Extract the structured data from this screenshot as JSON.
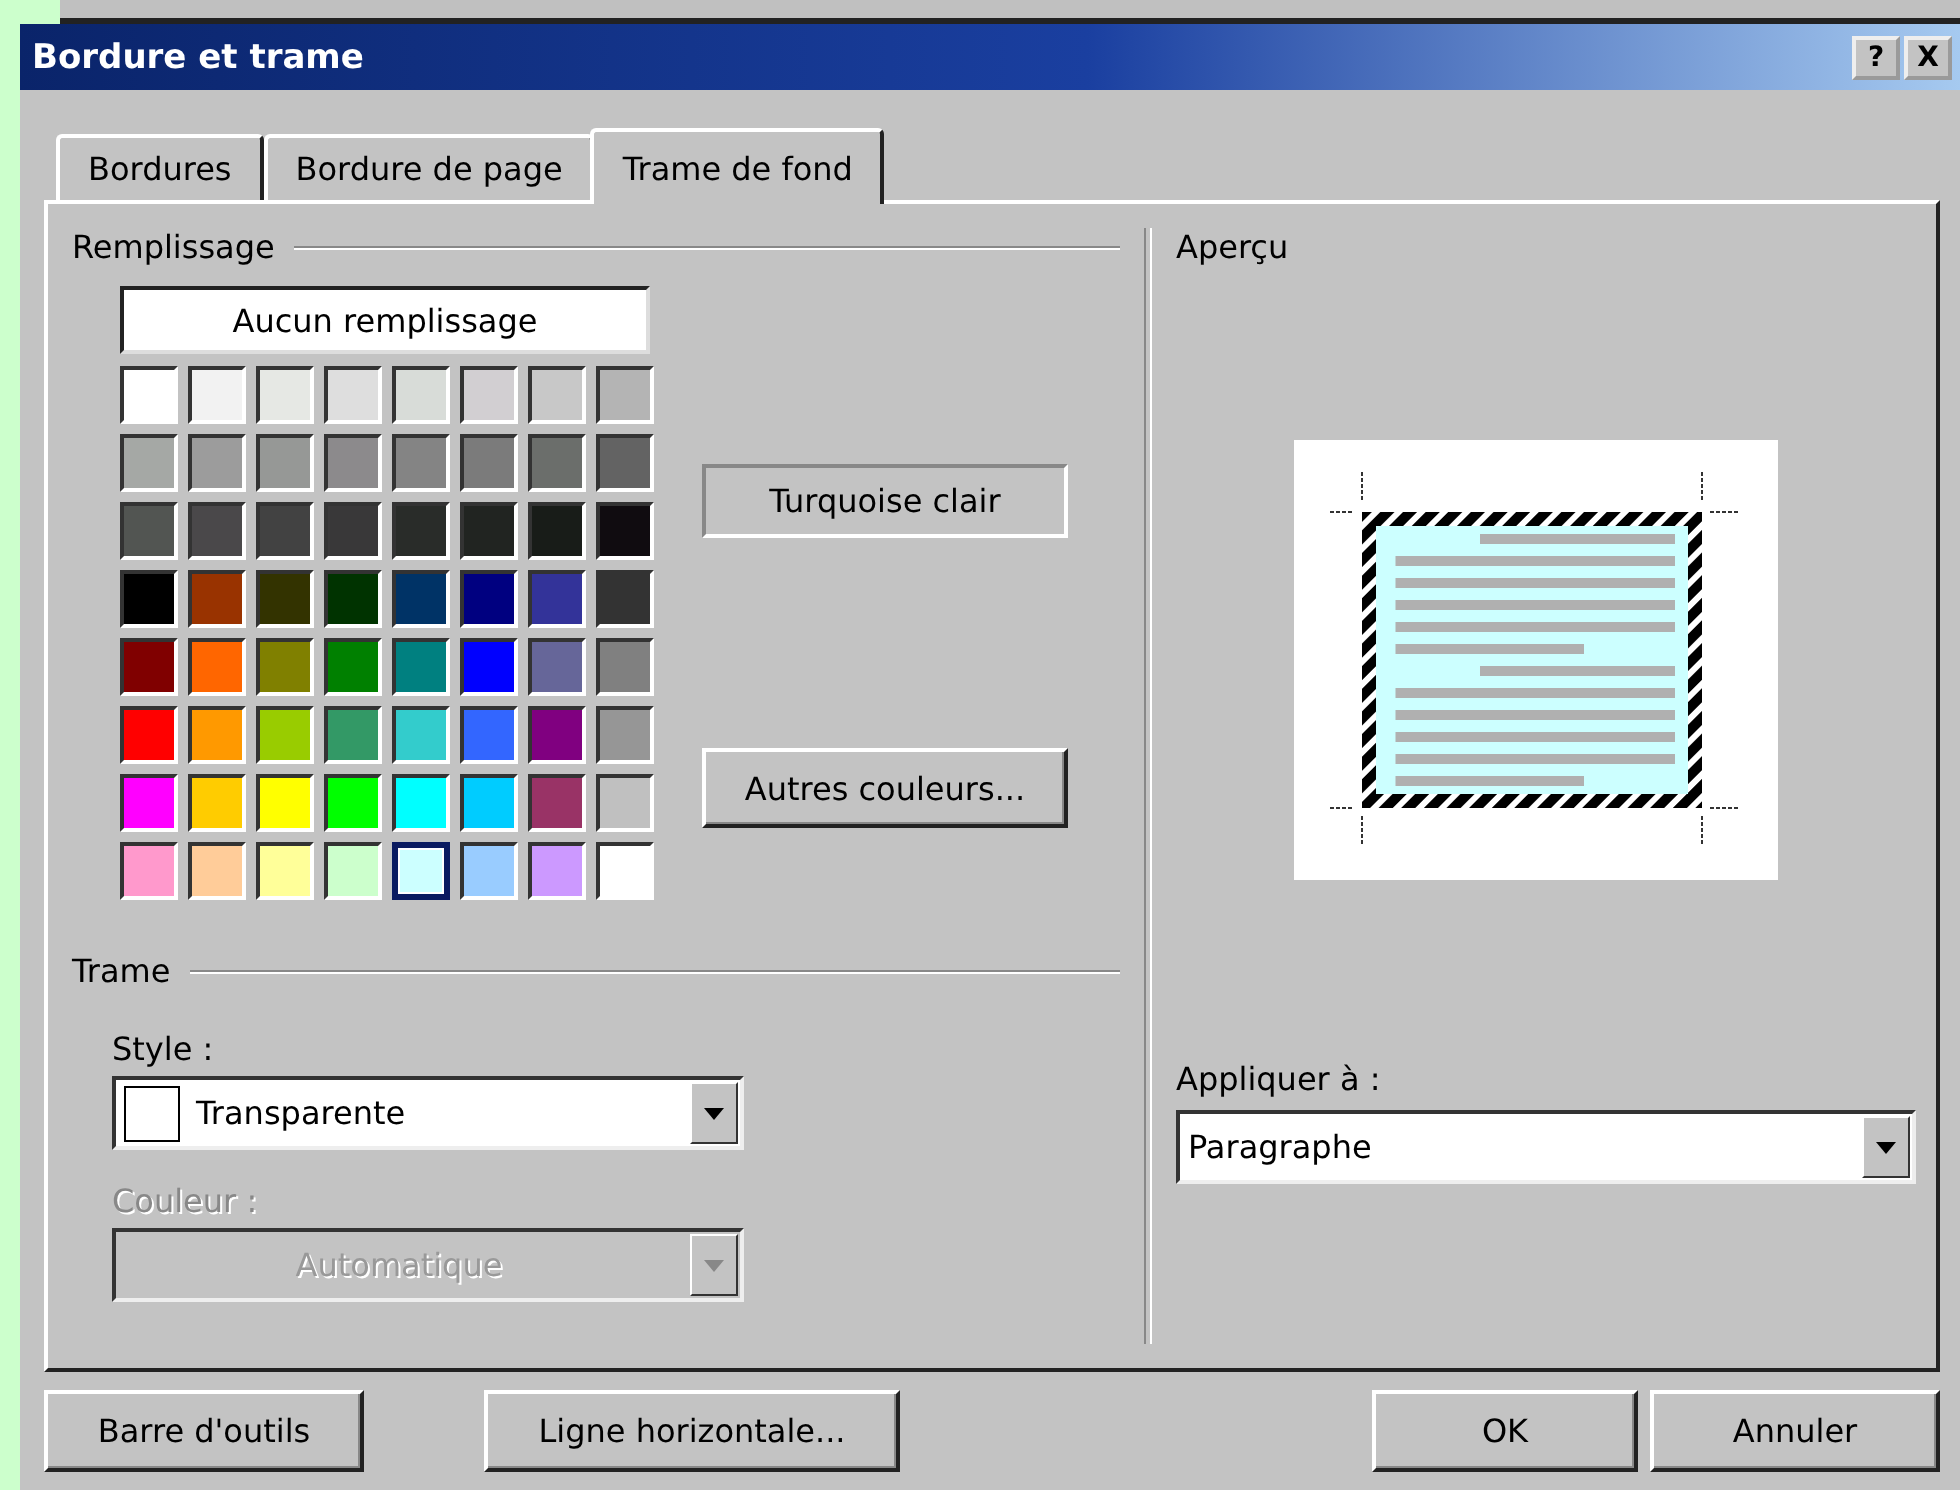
{
  "window": {
    "title": "Bordure et trame",
    "help_button": "?",
    "close_button": "X"
  },
  "tabs": [
    {
      "label": "Bordures",
      "selected": false
    },
    {
      "label": "Bordure de page",
      "selected": false
    },
    {
      "label": "Trame de fond",
      "selected": true
    }
  ],
  "fill": {
    "heading": "Remplissage",
    "no_fill": "Aucun remplissage",
    "color_name": "Turquoise clair",
    "more_colors": {
      "label": "Autres couleurs..."
    },
    "swatches": [
      {
        "color": "#ffffff",
        "selected": false
      },
      {
        "color": "#f2f2f2",
        "selected": false
      },
      {
        "color": "#e6e8e4",
        "selected": false
      },
      {
        "color": "#dedede",
        "selected": false
      },
      {
        "color": "#d8dcd8",
        "selected": false
      },
      {
        "color": "#d2cfd2",
        "selected": false
      },
      {
        "color": "#c8c8c8",
        "selected": false
      },
      {
        "color": "#b4b4b4",
        "selected": false
      },
      {
        "color": "#a5a8a5",
        "selected": false
      },
      {
        "color": "#9c9c9c",
        "selected": false
      },
      {
        "color": "#969896",
        "selected": false
      },
      {
        "color": "#8c8a8c",
        "selected": false
      },
      {
        "color": "#848484",
        "selected": false
      },
      {
        "color": "#7b7b7b",
        "selected": false
      },
      {
        "color": "#6b6e6b",
        "selected": false
      },
      {
        "color": "#636363",
        "selected": false
      },
      {
        "color": "#525552",
        "selected": false
      },
      {
        "color": "#4a484a",
        "selected": false
      },
      {
        "color": "#424242",
        "selected": false
      },
      {
        "color": "#393839",
        "selected": false
      },
      {
        "color": "#292c29",
        "selected": false
      },
      {
        "color": "#212421",
        "selected": false
      },
      {
        "color": "#181c18",
        "selected": false
      },
      {
        "color": "#100c10",
        "selected": false
      },
      {
        "color": "#000000",
        "selected": false
      },
      {
        "color": "#993300",
        "selected": false
      },
      {
        "color": "#333300",
        "selected": false
      },
      {
        "color": "#003300",
        "selected": false
      },
      {
        "color": "#003366",
        "selected": false
      },
      {
        "color": "#000080",
        "selected": false
      },
      {
        "color": "#333399",
        "selected": false
      },
      {
        "color": "#333333",
        "selected": false
      },
      {
        "color": "#800000",
        "selected": false
      },
      {
        "color": "#ff6600",
        "selected": false
      },
      {
        "color": "#808000",
        "selected": false
      },
      {
        "color": "#008000",
        "selected": false
      },
      {
        "color": "#008080",
        "selected": false
      },
      {
        "color": "#0000ff",
        "selected": false
      },
      {
        "color": "#666699",
        "selected": false
      },
      {
        "color": "#808080",
        "selected": false
      },
      {
        "color": "#ff0000",
        "selected": false
      },
      {
        "color": "#ff9900",
        "selected": false
      },
      {
        "color": "#99cc00",
        "selected": false
      },
      {
        "color": "#339966",
        "selected": false
      },
      {
        "color": "#33cccc",
        "selected": false
      },
      {
        "color": "#3366ff",
        "selected": false
      },
      {
        "color": "#800080",
        "selected": false
      },
      {
        "color": "#969696",
        "selected": false
      },
      {
        "color": "#ff00ff",
        "selected": false
      },
      {
        "color": "#ffcc00",
        "selected": false
      },
      {
        "color": "#ffff00",
        "selected": false
      },
      {
        "color": "#00ff00",
        "selected": false
      },
      {
        "color": "#00ffff",
        "selected": false
      },
      {
        "color": "#00ccff",
        "selected": false
      },
      {
        "color": "#993366",
        "selected": false
      },
      {
        "color": "#c0c0c0",
        "selected": false
      },
      {
        "color": "#ff99cc",
        "selected": false
      },
      {
        "color": "#ffcc99",
        "selected": false
      },
      {
        "color": "#ffff99",
        "selected": false
      },
      {
        "color": "#ccffcc",
        "selected": false
      },
      {
        "color": "#ccffff",
        "selected": true
      },
      {
        "color": "#99ccff",
        "selected": false
      },
      {
        "color": "#cc99ff",
        "selected": false
      },
      {
        "color": "#ffffff",
        "selected": false
      }
    ]
  },
  "pattern": {
    "heading": "Trame",
    "style": {
      "label": "Style :",
      "value": "Transparente",
      "disabled": false
    },
    "color": {
      "label": "Couleur :",
      "value": "Automatique",
      "disabled": true
    }
  },
  "preview": {
    "heading": "Aperçu",
    "apply_to": {
      "label": "Appliquer à :",
      "value": "Paragraphe"
    }
  },
  "footer": {
    "tool_buttons": [
      "Barre d'outils",
      "Ligne horizontale..."
    ],
    "dialog_buttons": [
      "OK",
      "Annuler"
    ]
  }
}
